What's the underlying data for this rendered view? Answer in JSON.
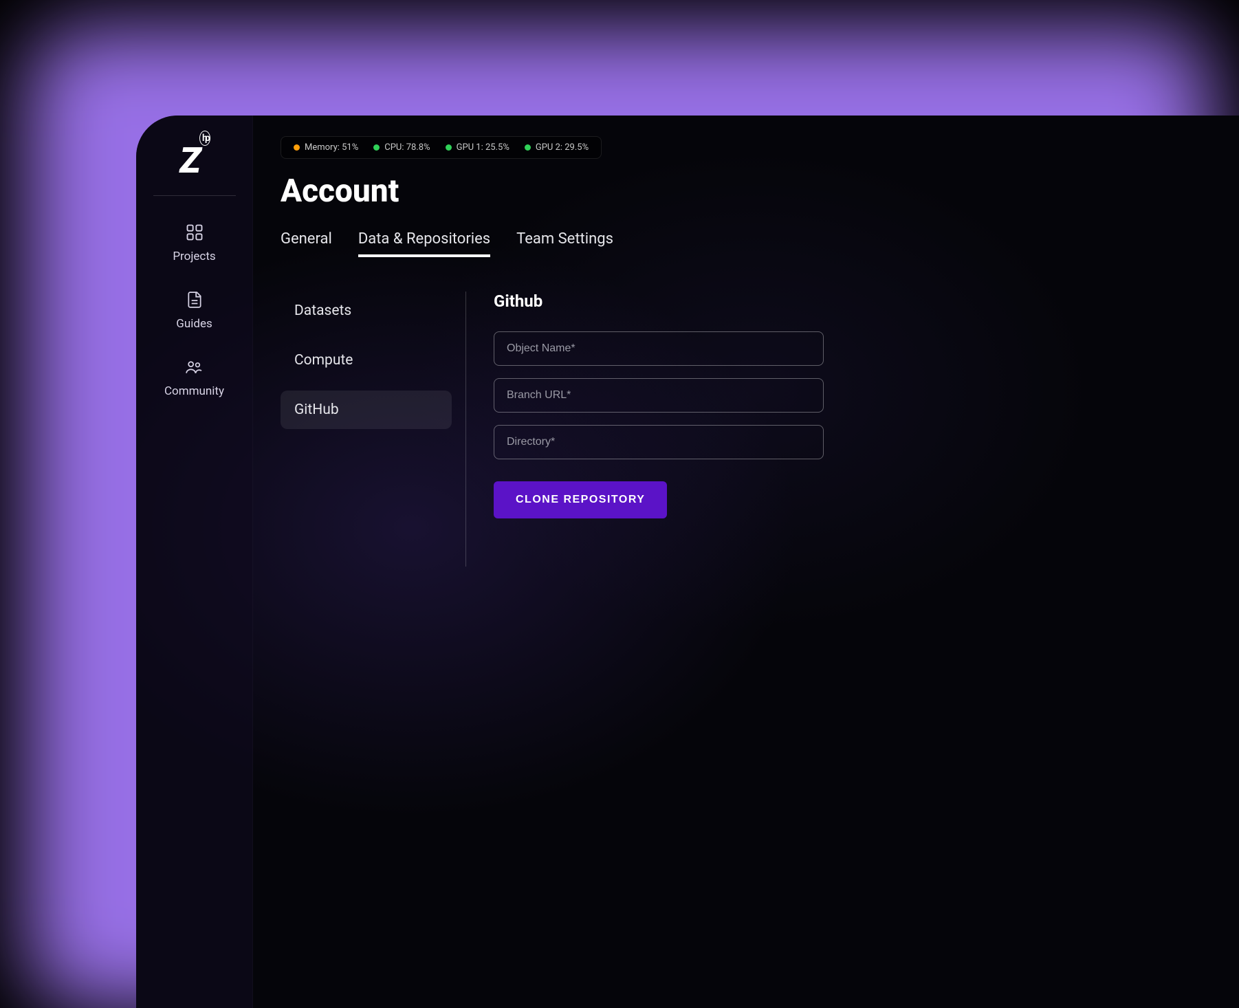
{
  "brand": {
    "logo_text": "Z",
    "logo_badge": "hp"
  },
  "sidebar": {
    "items": [
      {
        "label": "Projects"
      },
      {
        "label": "Guides"
      },
      {
        "label": "Community"
      }
    ]
  },
  "status": {
    "memory": {
      "label": "Memory: 51%",
      "color": "orange"
    },
    "cpu": {
      "label": "CPU: 78.8%",
      "color": "green"
    },
    "gpu1": {
      "label": "GPU 1: 25.5%",
      "color": "green"
    },
    "gpu2": {
      "label": "GPU 2: 29.5%",
      "color": "green"
    }
  },
  "page": {
    "title": "Account"
  },
  "tabs": [
    {
      "label": "General",
      "active": false
    },
    {
      "label": "Data & Repositories",
      "active": true
    },
    {
      "label": "Team Settings",
      "active": false
    }
  ],
  "subnav": [
    {
      "label": "Datasets",
      "active": false
    },
    {
      "label": "Compute",
      "active": false
    },
    {
      "label": "GitHub",
      "active": true
    }
  ],
  "panel": {
    "heading": "Github",
    "fields": {
      "object_name": {
        "placeholder": "Object Name*",
        "value": ""
      },
      "branch_url": {
        "placeholder": "Branch URL*",
        "value": ""
      },
      "directory": {
        "placeholder": "Directory*",
        "value": ""
      }
    },
    "button_label": "CLONE REPOSITORY"
  },
  "colors": {
    "accent": "#5b13c7",
    "glow": "#a87cff"
  }
}
